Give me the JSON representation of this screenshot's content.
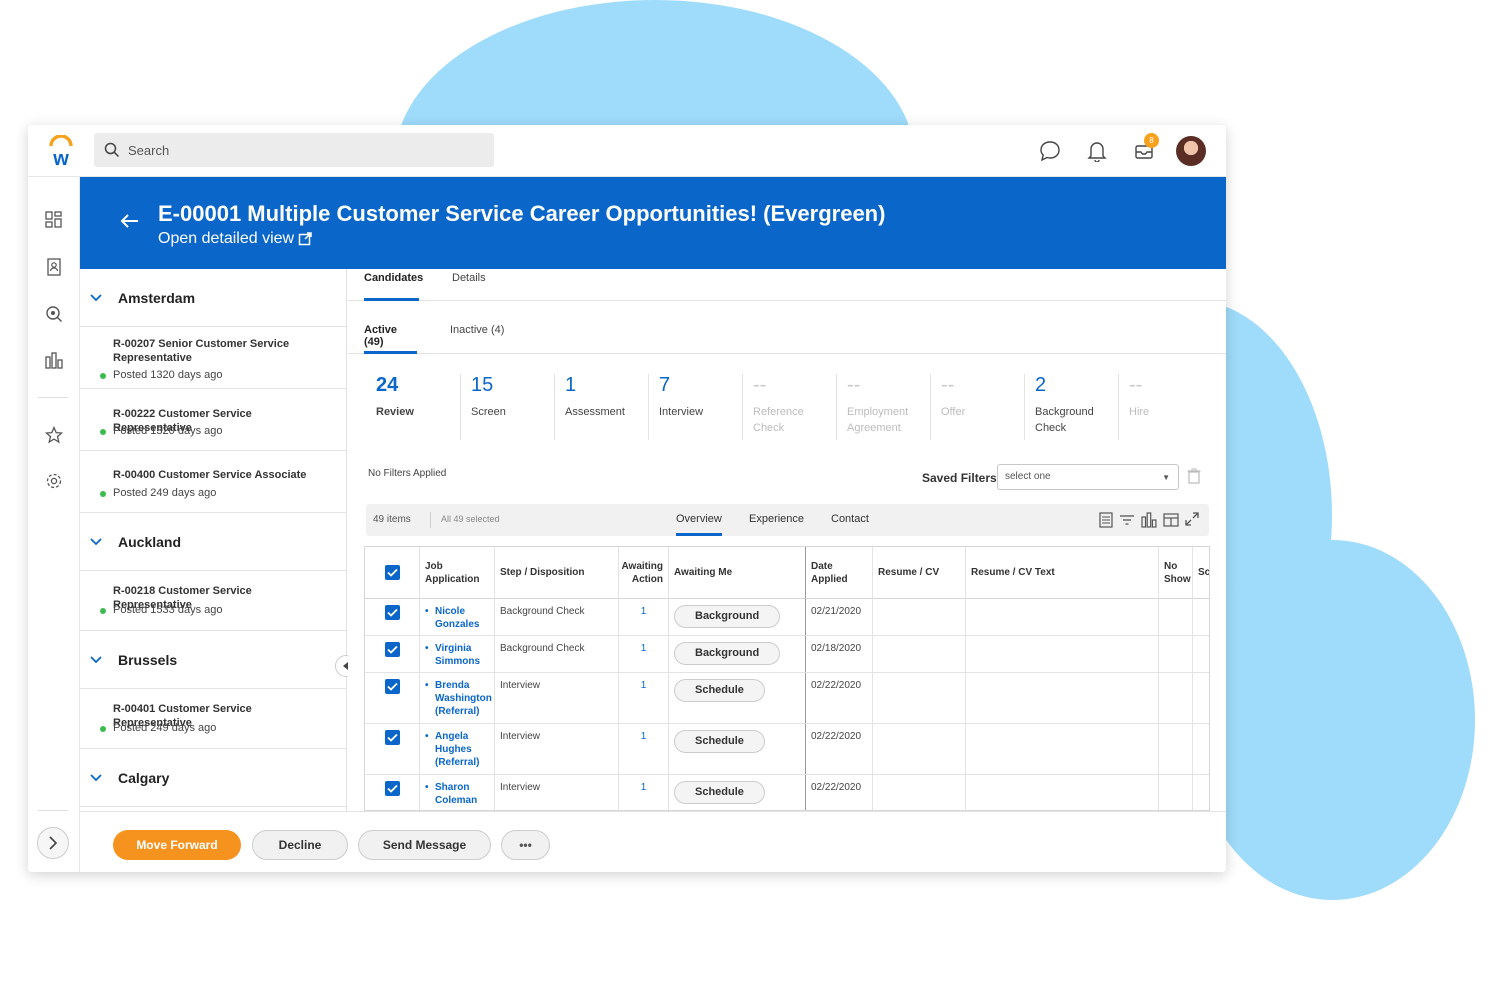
{
  "search": {
    "placeholder": "Search"
  },
  "header": {
    "inbox_badge": "8"
  },
  "banner": {
    "title": "E-00001 Multiple Customer Service Career Opportunities! (Evergreen)",
    "link": "Open detailed view"
  },
  "groups": [
    {
      "city": "Amsterdam",
      "reqs": [
        {
          "title": "R-00207 Senior Customer Service Representative",
          "posted": "Posted 1320 days ago"
        },
        {
          "title": "R-00222 Customer Service Representative",
          "posted": "Posted 1320 days ago"
        },
        {
          "title": "R-00400 Customer Service Associate",
          "posted": "Posted 249 days ago"
        }
      ]
    },
    {
      "city": "Auckland",
      "reqs": [
        {
          "title": "R-00218 Customer Service Representative",
          "posted": "Posted 1533 days ago"
        }
      ]
    },
    {
      "city": "Brussels",
      "reqs": [
        {
          "title": "R-00401 Customer Service Representative",
          "posted": "Posted 249 days ago"
        }
      ]
    },
    {
      "city": "Calgary",
      "reqs": []
    }
  ],
  "tabs": [
    "Candidates",
    "Details"
  ],
  "subtabs": [
    "Active (49)",
    "Inactive (4)"
  ],
  "stages": [
    {
      "count": "24",
      "label": "Review",
      "muted": false
    },
    {
      "count": "15",
      "label": "Screen",
      "muted": false
    },
    {
      "count": "1",
      "label": "Assessment",
      "muted": false
    },
    {
      "count": "7",
      "label": "Interview",
      "muted": false
    },
    {
      "count": "--",
      "label": "Reference Check",
      "muted": true
    },
    {
      "count": "--",
      "label": "Employment Agreement",
      "muted": true
    },
    {
      "count": "--",
      "label": "Offer",
      "muted": true
    },
    {
      "count": "2",
      "label": "Background Check",
      "muted": false
    },
    {
      "count": "--",
      "label": "Hire",
      "muted": true
    }
  ],
  "filters": {
    "status": "No Filters Applied",
    "saved_label": "Saved Filters",
    "saved_value": "select one"
  },
  "grid": {
    "items": "49 items",
    "selected": "All 49 selected",
    "tabs": [
      "Overview",
      "Experience",
      "Contact"
    ],
    "columns": [
      "Job Application",
      "Step / Disposition",
      "Awaiting Action",
      "Awaiting Me",
      "Date Applied",
      "Resume / CV",
      "Resume / CV Text",
      "No Show",
      "Sc"
    ],
    "rows": [
      {
        "name": "Nicole Gonzales",
        "step": "Background Check",
        "awaiting": "1",
        "action": "Background",
        "date": "02/21/2020"
      },
      {
        "name": "Virginia Simmons",
        "step": "Background Check",
        "awaiting": "1",
        "action": "Background",
        "date": "02/18/2020"
      },
      {
        "name": "Brenda Washington (Referral)",
        "step": "Interview",
        "awaiting": "1",
        "action": "Schedule",
        "date": "02/22/2020"
      },
      {
        "name": "Angela Hughes (Referral)",
        "step": "Interview",
        "awaiting": "1",
        "action": "Schedule",
        "date": "02/22/2020"
      },
      {
        "name": "Sharon Coleman",
        "step": "Interview",
        "awaiting": "1",
        "action": "Schedule",
        "date": "02/22/2020"
      }
    ]
  },
  "actions": {
    "move_forward": "Move Forward",
    "decline": "Decline",
    "send_message": "Send Message",
    "more": "•••"
  },
  "colors": {
    "brand_blue": "#0a66c9",
    "accent_orange": "#f6921e",
    "cloud": "#9fdcfb"
  }
}
